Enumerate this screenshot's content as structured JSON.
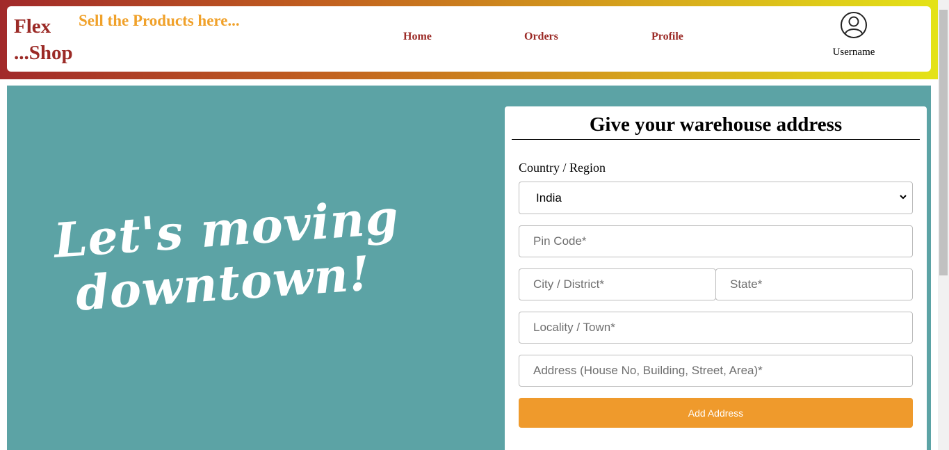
{
  "header": {
    "brand_line1": "Flex",
    "brand_line2": "...Shop",
    "tagline": "Sell the Products here...",
    "nav": [
      {
        "label": "Home"
      },
      {
        "label": "Orders"
      },
      {
        "label": "Profile"
      }
    ],
    "user": {
      "name": "Username",
      "icon": "user-avatar-icon"
    }
  },
  "hero": {
    "line1": "Let's moving",
    "line2": "downtown!"
  },
  "form": {
    "title": "Give your warehouse address",
    "country_label": "Country / Region",
    "country_value": "India",
    "pin_placeholder": "Pin Code*",
    "city_placeholder": "City / District*",
    "state_placeholder": "State*",
    "locality_placeholder": "Locality / Town*",
    "address_placeholder": "Address (House No, Building, Street, Area)*",
    "submit_label": "Add Address"
  },
  "colors": {
    "brand": "#9b2a26",
    "tagline": "#f0a12a",
    "hero_bg": "#5ca3a5",
    "button": "#ef9a2c"
  }
}
